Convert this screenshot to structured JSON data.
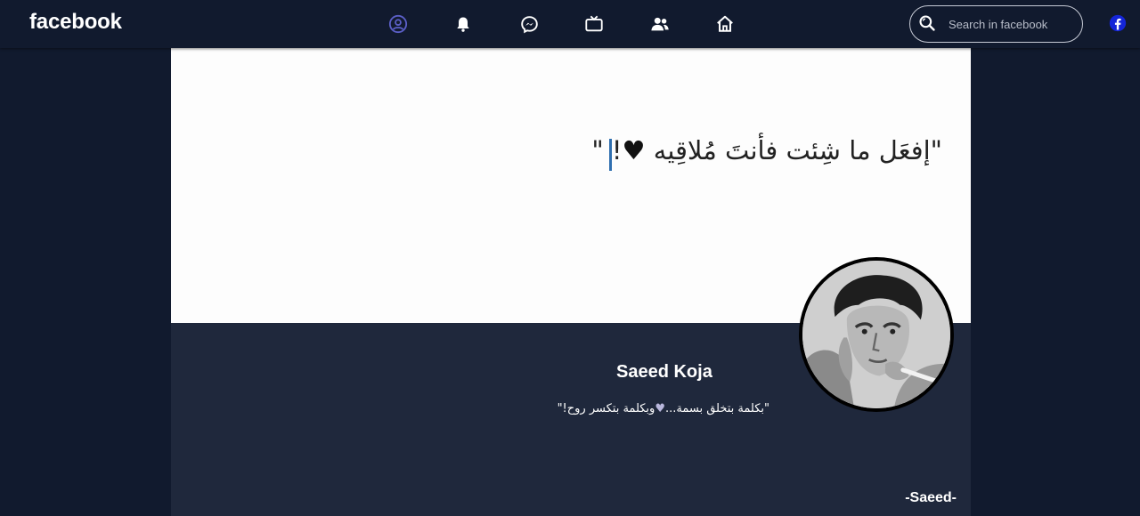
{
  "header": {
    "logo": "facebook",
    "nav": [
      {
        "icon": "user-circle-icon",
        "active": true
      },
      {
        "icon": "bell-icon",
        "active": false
      },
      {
        "icon": "messenger-icon",
        "active": false
      },
      {
        "icon": "tv-icon",
        "active": false
      },
      {
        "icon": "friends-icon",
        "active": false
      },
      {
        "icon": "home-icon",
        "active": false
      }
    ],
    "search": {
      "placeholder": "Search in facebook",
      "value": ""
    },
    "corner_icon": "facebook-logo-icon"
  },
  "cover": {
    "quote": "\"إفعَل ما شِئت فأنتَ مُلاقِيه ",
    "quote_end": "! \"",
    "heart": "♥"
  },
  "profile": {
    "name": "Saeed Koja",
    "bio_start": "\"بكلمة بتخلق بسمة...",
    "bio_heart": "♥",
    "bio_end": "وبكلمة بتكسر روح!\"",
    "signature": "-Saeed-"
  },
  "colors": {
    "background": "#111a2e",
    "cover_bg": "#fdfdfd",
    "info_bg": "#1f283c",
    "active_nav": "#5b5fc7",
    "fb_blue": "#1877f2",
    "bio_heart": "#b9b7dd"
  }
}
